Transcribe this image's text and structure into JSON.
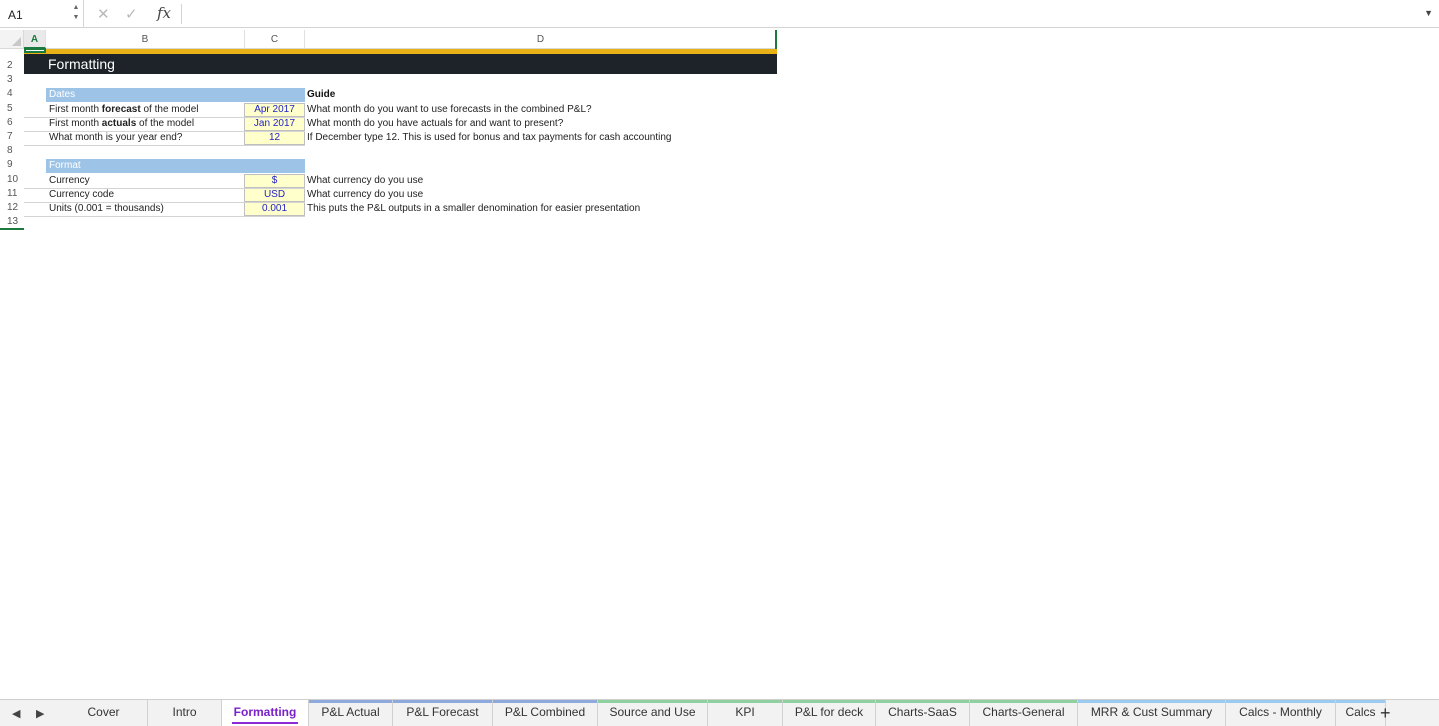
{
  "formula_bar": {
    "name_box": "A1",
    "cancel_glyph": "✕",
    "confirm_glyph": "✓",
    "fx_glyph": "fx",
    "formula_value": ""
  },
  "columns": [
    "A",
    "B",
    "C",
    "D"
  ],
  "rows": [
    "2",
    "3",
    "4",
    "5",
    "6",
    "7",
    "8",
    "9",
    "10",
    "11",
    "12",
    "13"
  ],
  "sheet": {
    "title": "Formatting",
    "dates_header": "Dates",
    "guide_header": "Guide",
    "format_header": "Format",
    "dates_rows": [
      {
        "pre": "First month ",
        "bold": "forecast",
        "post": " of the model",
        "value": "Apr 2017",
        "guide": "What month do you want to use forecasts in the combined P&L?"
      },
      {
        "pre": "First month ",
        "bold": "actuals",
        "post": " of the model",
        "value": "Jan 2017",
        "guide": "What month do you have actuals for and want to present?"
      },
      {
        "pre": "What month is your year end?",
        "bold": "",
        "post": "",
        "value": "12",
        "guide": "If December type 12. This is used for bonus and tax payments for cash accounting"
      }
    ],
    "format_rows": [
      {
        "label": "Currency",
        "value": "$",
        "guide": "What currency do you use"
      },
      {
        "label": "Currency code",
        "value": "USD",
        "guide": "What currency do you use"
      },
      {
        "label": "Units (0.001 = thousands)",
        "value": "0.001",
        "guide": "This puts the P&L outputs in a smaller denomination for easier presentation"
      }
    ]
  },
  "colors": {
    "accent_green": "#1b7a3d",
    "title_bg": "#1e2329",
    "gold": "#e8b115",
    "section_blue": "#9dc3e6",
    "input_yellow": "#ffffcc",
    "active_tab": "#7a21c9"
  },
  "tabs": [
    {
      "label": "Cover",
      "stripe": ""
    },
    {
      "label": "Intro",
      "stripe": ""
    },
    {
      "label": "Formatting",
      "stripe": "",
      "active": true
    },
    {
      "label": "P&L Actual",
      "stripe": "#8ea9db"
    },
    {
      "label": "P&L Forecast",
      "stripe": "#8ea9db"
    },
    {
      "label": "P&L Combined",
      "stripe": "#8ea9db"
    },
    {
      "label": "Source and Use",
      "stripe": "#8fd19e"
    },
    {
      "label": "KPI",
      "stripe": "#8fd19e"
    },
    {
      "label": "P&L for deck",
      "stripe": "#8fd19e"
    },
    {
      "label": "Charts-SaaS",
      "stripe": "#8fd19e"
    },
    {
      "label": "Charts-General",
      "stripe": "#8fd19e"
    },
    {
      "label": "MRR & Cust Summary",
      "stripe": "#9cc9ef"
    },
    {
      "label": "Calcs - Monthly",
      "stripe": "#9cc9ef"
    },
    {
      "label": "Calcs",
      "stripe": "#9cc9ef"
    }
  ],
  "tab_nav": {
    "prev": "◀",
    "next": "▶",
    "add": "+"
  }
}
